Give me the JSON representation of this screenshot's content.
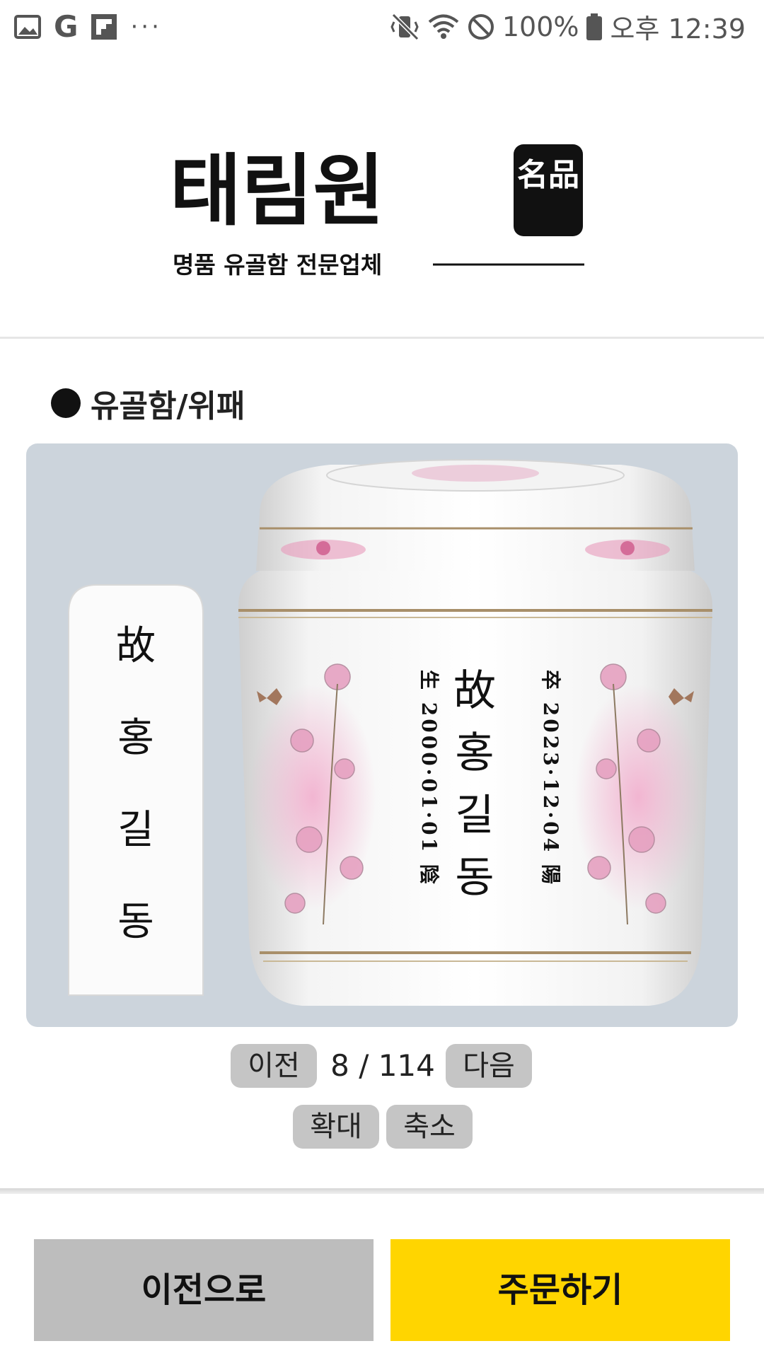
{
  "status_bar": {
    "battery": "100%",
    "time": "오후 12:39",
    "left_icons": [
      "gallery-icon",
      "google-icon",
      "flipboard-icon",
      "more-icon"
    ],
    "right_icons": [
      "vibrate-icon",
      "wifi-icon",
      "block-icon",
      "battery-icon"
    ]
  },
  "logo": {
    "name": "태림원",
    "badge": "名品",
    "tagline": "명품 유골함 전문업체"
  },
  "section": {
    "title": "유골함/위패"
  },
  "product": {
    "tablet_text": [
      "故",
      "홍",
      "길",
      "동"
    ],
    "urn_center": [
      "故",
      "홍",
      "길",
      "동"
    ],
    "urn_left": "生 2000·01·01 陰",
    "urn_right": "卒 2023·12·04 陽"
  },
  "pager": {
    "prev_label": "이전",
    "count": "8 / 114",
    "next_label": "다음"
  },
  "zoom": {
    "zoom_in_label": "확대",
    "zoom_out_label": "축소"
  },
  "bottom": {
    "back_label": "이전으로",
    "order_label": "주문하기"
  },
  "colors": {
    "order_button": "#ffd500",
    "back_button": "#bdbdbd",
    "small_button": "#c5c5c5",
    "image_background": "#ccd4dc"
  }
}
